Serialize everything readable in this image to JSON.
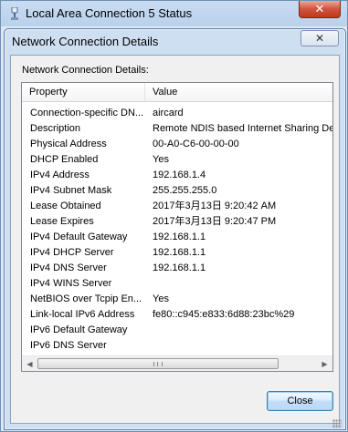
{
  "back_window": {
    "title": "Local Area Connection 5 Status",
    "close_glyph": "✕"
  },
  "dialog": {
    "title": "Network Connection Details",
    "close_glyph": "✕",
    "section_label": "Network Connection Details:",
    "columns": {
      "property": "Property",
      "value": "Value"
    },
    "rows": [
      {
        "property": "Connection-specific DN...",
        "value": "aircard"
      },
      {
        "property": "Description",
        "value": "Remote NDIS based Internet Sharing Dev"
      },
      {
        "property": "Physical Address",
        "value": "00-A0-C6-00-00-00"
      },
      {
        "property": "DHCP Enabled",
        "value": "Yes"
      },
      {
        "property": "IPv4 Address",
        "value": "192.168.1.4"
      },
      {
        "property": "IPv4 Subnet Mask",
        "value": "255.255.255.0"
      },
      {
        "property": "Lease Obtained",
        "value": "2017年3月13日 9:20:42 AM"
      },
      {
        "property": "Lease Expires",
        "value": "2017年3月13日 9:20:47 PM"
      },
      {
        "property": "IPv4 Default Gateway",
        "value": "192.168.1.1"
      },
      {
        "property": "IPv4 DHCP Server",
        "value": "192.168.1.1"
      },
      {
        "property": "IPv4 DNS Server",
        "value": "192.168.1.1"
      },
      {
        "property": "IPv4 WINS Server",
        "value": ""
      },
      {
        "property": "NetBIOS over Tcpip En...",
        "value": "Yes"
      },
      {
        "property": "Link-local IPv6 Address",
        "value": "fe80::c945:e833:6d88:23bc%29"
      },
      {
        "property": "IPv6 Default Gateway",
        "value": ""
      },
      {
        "property": "IPv6 DNS Server",
        "value": ""
      }
    ],
    "scroll_left_glyph": "◀",
    "scroll_right_glyph": "▶",
    "close_button_label": "Close"
  }
}
